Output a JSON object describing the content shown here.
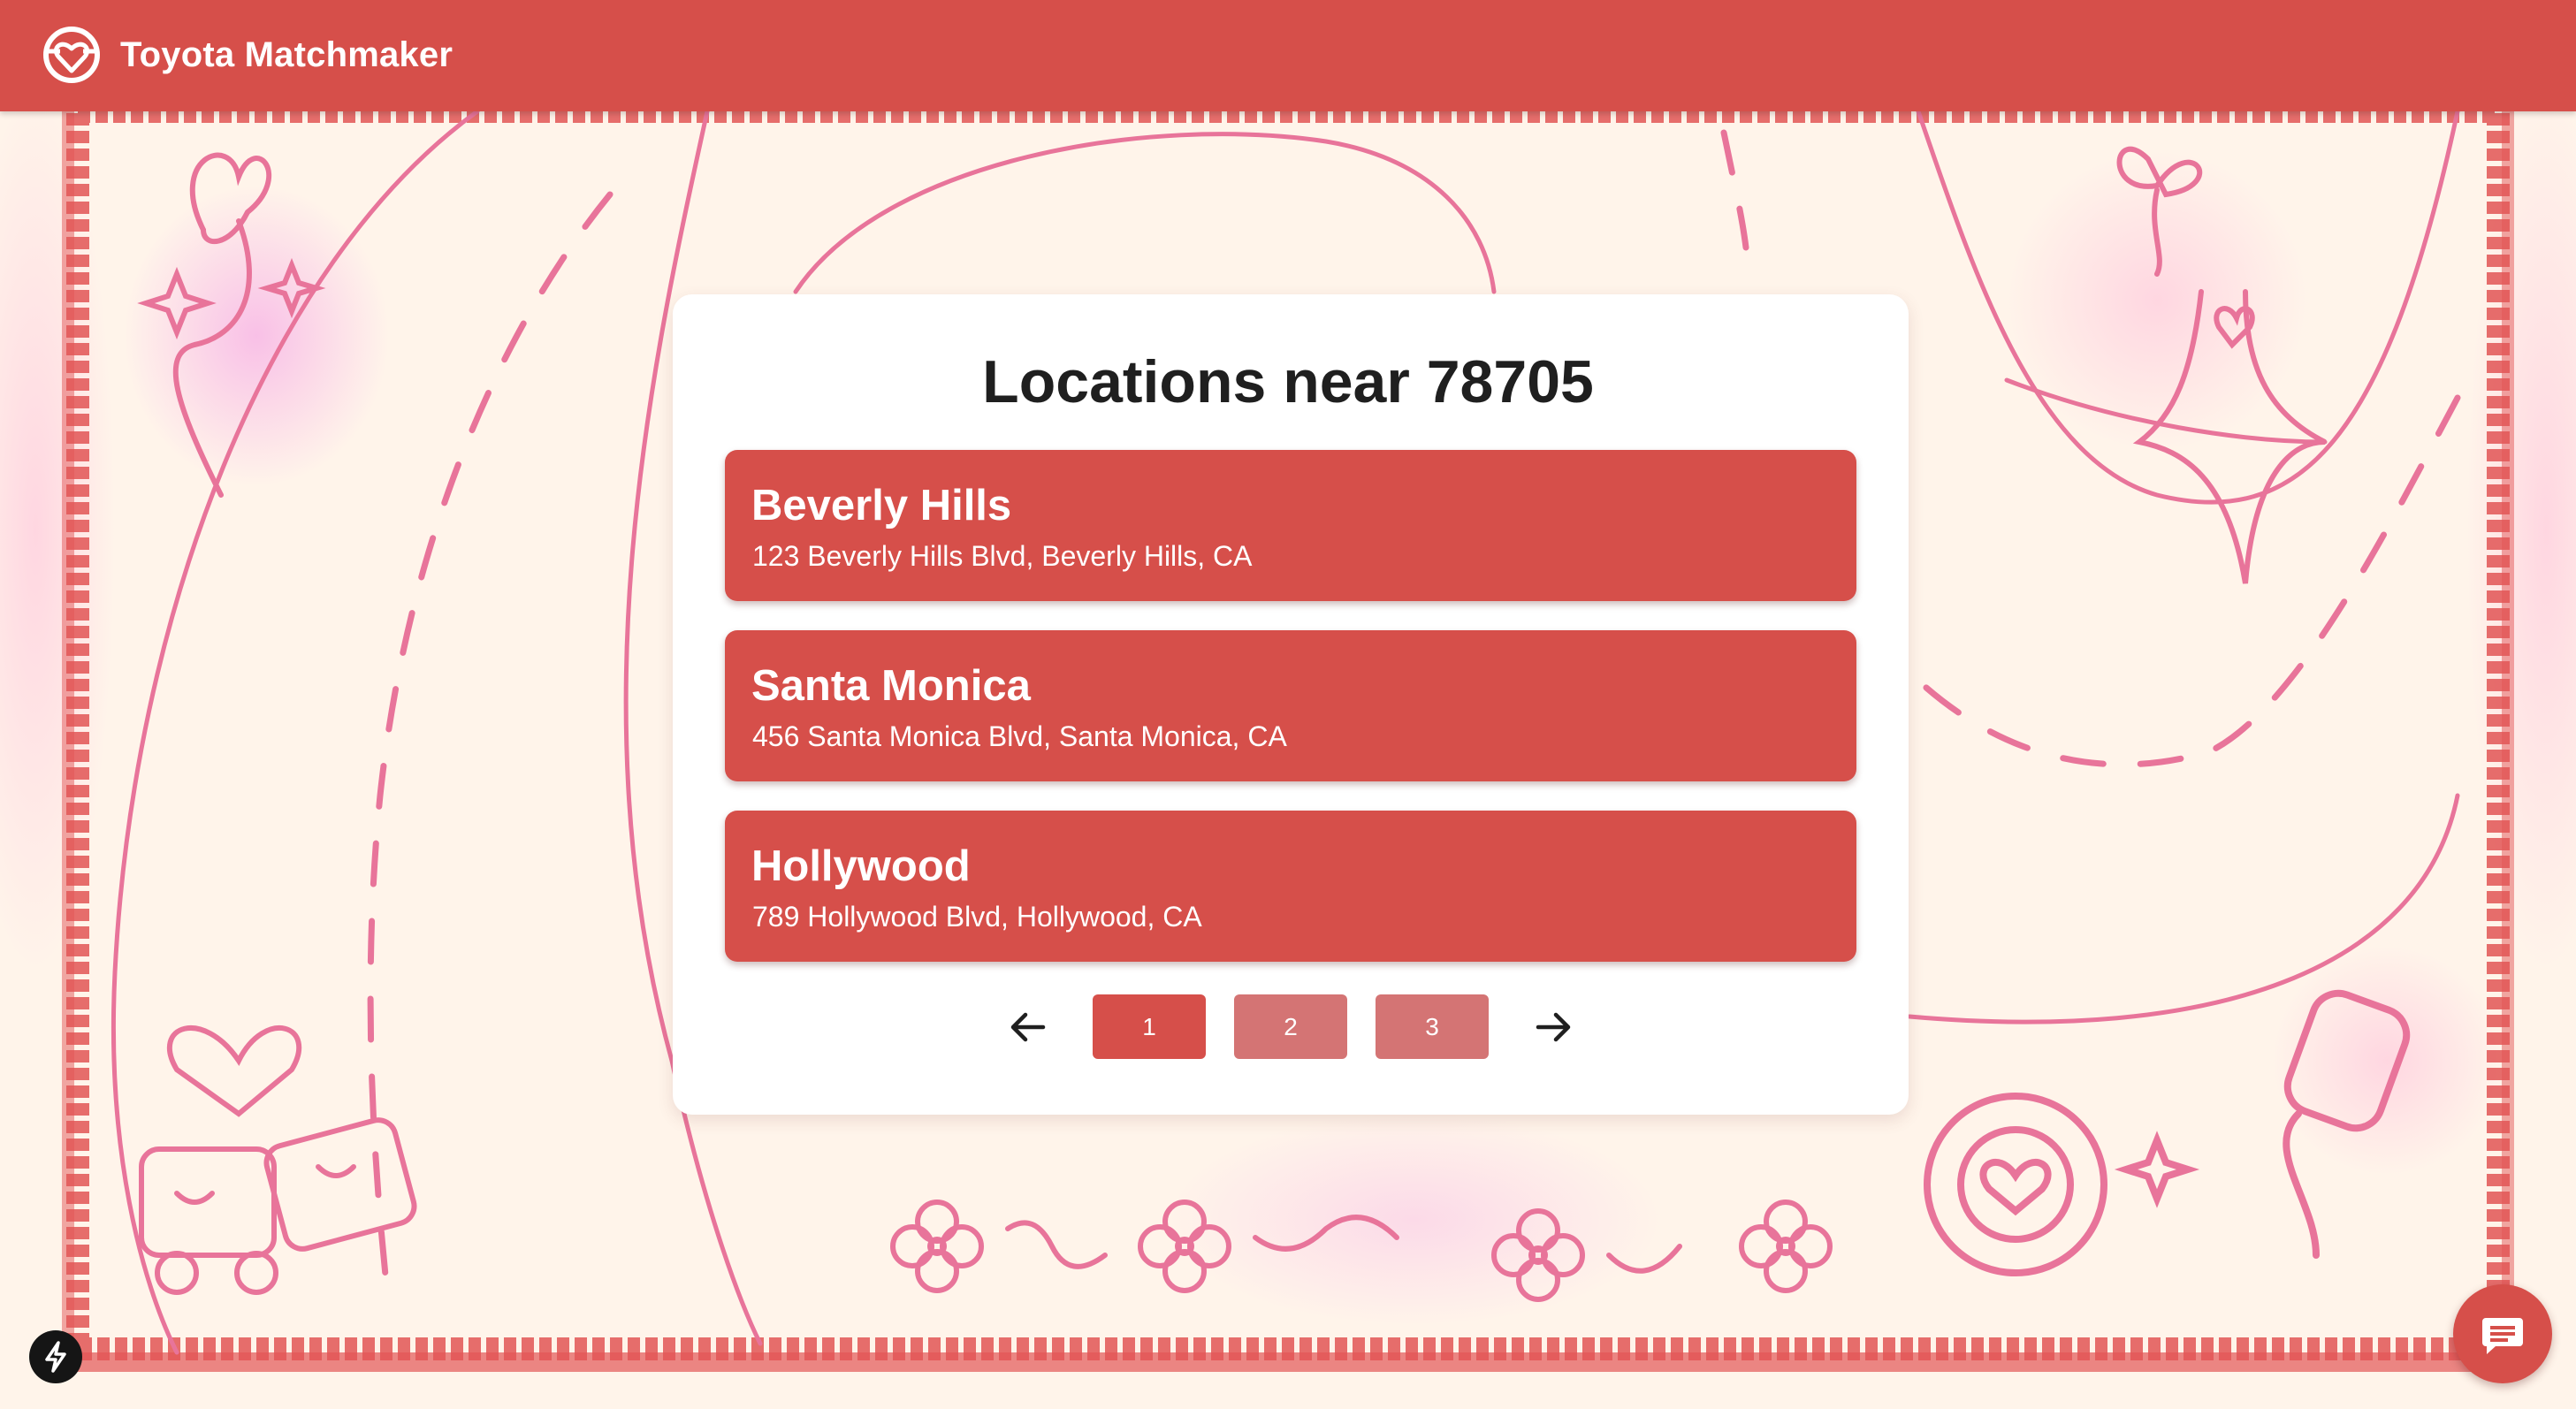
{
  "header": {
    "title": "Toyota Matchmaker",
    "logo_icon": "steering-wheel-heart-icon",
    "background": "#d64f4a"
  },
  "main": {
    "heading": "Locations near 78705",
    "locations": [
      {
        "name": "Beverly Hills",
        "address": "123 Beverly Hills Blvd, Beverly Hills, CA"
      },
      {
        "name": "Santa Monica",
        "address": "456 Santa Monica Blvd, Santa Monica, CA"
      },
      {
        "name": "Hollywood",
        "address": "789 Hollywood Blvd, Hollywood, CA"
      }
    ]
  },
  "pagination": {
    "prev_icon": "arrow-left-icon",
    "next_icon": "arrow-right-icon",
    "pages": [
      "1",
      "2",
      "3"
    ],
    "current_page": "1"
  },
  "widgets": {
    "bolt_icon": "lightning-bolt-icon",
    "chat_icon": "chat-bubble-icon"
  },
  "colors": {
    "accent": "#d64f4a",
    "inactive_page": "#d47474",
    "doodle_pink": "#e8749a",
    "frame_red": "#e25555"
  }
}
